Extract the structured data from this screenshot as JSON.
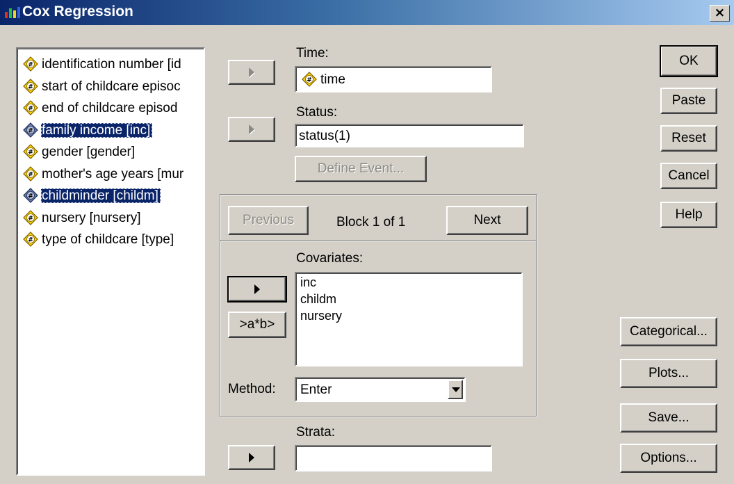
{
  "window": {
    "title": "Cox Regression",
    "close_glyph": "×"
  },
  "variables": [
    {
      "label": "identification number [id",
      "icon": "scale-variable-icon",
      "selected": false
    },
    {
      "label": "start of childcare episoc",
      "icon": "scale-variable-icon",
      "selected": false
    },
    {
      "label": "end of childcare episod",
      "icon": "scale-variable-icon",
      "selected": false
    },
    {
      "label": "family income [inc]",
      "icon": "scale-variable-icon",
      "selected": true
    },
    {
      "label": "gender [gender]",
      "icon": "scale-variable-icon",
      "selected": false
    },
    {
      "label": "mother's age years [mur",
      "icon": "scale-variable-icon",
      "selected": false
    },
    {
      "label": "childminder [childm]",
      "icon": "scale-variable-icon",
      "selected": true
    },
    {
      "label": "nursery [nursery]",
      "icon": "scale-variable-icon",
      "selected": false
    },
    {
      "label": "type of childcare [type]",
      "icon": "scale-variable-icon",
      "selected": false
    }
  ],
  "time": {
    "label": "Time:",
    "value": "time"
  },
  "status": {
    "label": "Status:",
    "value": "status(1)",
    "define_event": "Define Event..."
  },
  "block": {
    "previous": "Previous",
    "text": "Block 1 of 1",
    "next": "Next"
  },
  "covariates": {
    "label": "Covariates:",
    "items": [
      "inc",
      "childm",
      "nursery"
    ],
    "interaction_button": ">a*b>"
  },
  "method": {
    "label": "Method:",
    "value": "Enter"
  },
  "strata": {
    "label": "Strata:",
    "value": ""
  },
  "buttons": {
    "ok": "OK",
    "paste": "Paste",
    "reset": "Reset",
    "cancel": "Cancel",
    "help": "Help",
    "categorical": "Categorical...",
    "plots": "Plots...",
    "save": "Save...",
    "options": "Options..."
  },
  "colors": {
    "face": "#d4d0c8",
    "selection": "#0a246a",
    "title_start": "#0a246a",
    "title_end": "#a6caf0",
    "icon_yellow": "#ffd700"
  }
}
